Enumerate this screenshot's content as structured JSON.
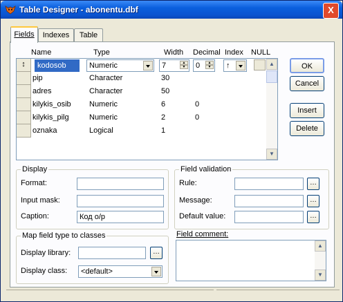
{
  "window": {
    "title": "Table Designer - abonentu.dbf",
    "close_glyph": "X"
  },
  "tabs": [
    {
      "label": "Fields",
      "active": true
    },
    {
      "label": "Indexes",
      "active": false
    },
    {
      "label": "Table",
      "active": false
    }
  ],
  "columns": {
    "name": "Name",
    "type": "Type",
    "width": "Width",
    "decimal": "Decimal",
    "index": "Index",
    "null": "NULL"
  },
  "fields": [
    {
      "name": "kodosob",
      "type": "Numeric",
      "width": "7",
      "decimal": "0",
      "index": "↑"
    },
    {
      "name": "pip",
      "type": "Character",
      "width": "30",
      "decimal": ""
    },
    {
      "name": "adres",
      "type": "Character",
      "width": "50",
      "decimal": ""
    },
    {
      "name": "kilykis_osib",
      "type": "Numeric",
      "width": "6",
      "decimal": "0"
    },
    {
      "name": "kilykis_pilg",
      "type": "Numeric",
      "width": "2",
      "decimal": "0"
    },
    {
      "name": "oznaka",
      "type": "Logical",
      "width": "1",
      "decimal": ""
    }
  ],
  "selected_row_marker": "↕",
  "buttons": {
    "ok": "OK",
    "cancel": "Cancel",
    "insert": "Insert",
    "delete": "Delete"
  },
  "display": {
    "title": "Display",
    "format_label": "Format:",
    "format_value": "",
    "input_mask_label": "Input mask:",
    "input_mask_value": "",
    "caption_label": "Caption:",
    "caption_value": "Код о/р"
  },
  "field_validation": {
    "title": "Field validation",
    "rule_label": "Rule:",
    "rule_value": "",
    "message_label": "Message:",
    "message_value": "",
    "default_label": "Default value:",
    "default_value": ""
  },
  "map_classes": {
    "title": "Map field type to classes",
    "library_label": "Display library:",
    "library_value": "",
    "class_label": "Display class:",
    "class_value": "<default>"
  },
  "field_comment": {
    "title": "Field comment:",
    "value": ""
  },
  "colors": {
    "title_bar": "#0a54d0",
    "selection": "#316ac5",
    "panel": "#ece9d8"
  }
}
